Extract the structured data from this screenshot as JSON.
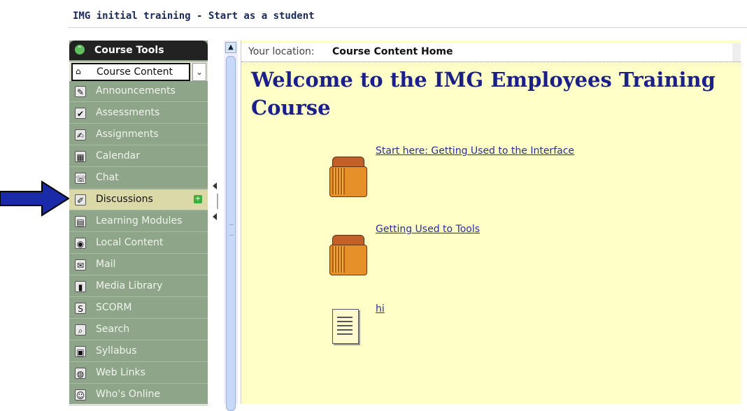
{
  "window": {
    "title": "IMG initial training - Start as a student"
  },
  "sidebar": {
    "header": "Course Tools",
    "selected_tool": "Course Content",
    "items": [
      {
        "label": "Announcements",
        "icon": "megaphone-icon"
      },
      {
        "label": "Assessments",
        "icon": "assessment-icon"
      },
      {
        "label": "Assignments",
        "icon": "assignment-icon"
      },
      {
        "label": "Calendar",
        "icon": "calendar-icon"
      },
      {
        "label": "Chat",
        "icon": "chat-icon"
      },
      {
        "label": "Discussions",
        "icon": "pushpin-icon",
        "active": true
      },
      {
        "label": "Learning Modules",
        "icon": "modules-icon"
      },
      {
        "label": "Local Content",
        "icon": "cd-icon"
      },
      {
        "label": "Mail",
        "icon": "mail-icon"
      },
      {
        "label": "Media Library",
        "icon": "media-icon"
      },
      {
        "label": "SCORM",
        "icon": "scorm-icon"
      },
      {
        "label": "Search",
        "icon": "search-icon"
      },
      {
        "label": "Syllabus",
        "icon": "syllabus-icon"
      },
      {
        "label": "Web Links",
        "icon": "globe-icon"
      },
      {
        "label": "Who's Online",
        "icon": "person-icon"
      }
    ]
  },
  "content": {
    "location_label": "Your location:",
    "location_value": "Course Content Home",
    "welcome": "Welcome to the IMG Employees Training Course",
    "entries": [
      {
        "label": "Start here: Getting Used to the Interface",
        "icon": "folder-icon"
      },
      {
        "label": "Getting Used to Tools",
        "icon": "folder-icon"
      },
      {
        "label": "hi",
        "icon": "document-icon"
      }
    ]
  },
  "colors": {
    "sidebar_bg": "#8ea58a",
    "content_bg": "#ffffc8",
    "heading": "#1b1f8a",
    "arrow": "#1a2aa8"
  }
}
